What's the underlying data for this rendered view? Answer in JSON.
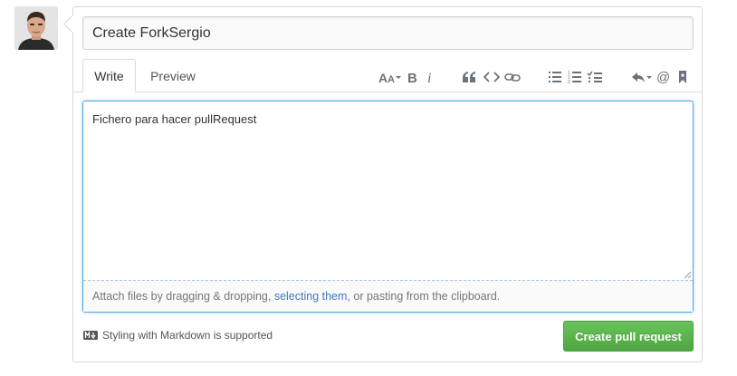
{
  "avatar": {
    "icon": "user-avatar"
  },
  "composer": {
    "title_value": "Create ForkSergio",
    "tabs": [
      {
        "label": "Write",
        "active": true
      },
      {
        "label": "Preview",
        "active": false
      }
    ],
    "toolbar_icons": [
      "header-icon",
      "bold-icon",
      "italic-icon",
      "quote-icon",
      "code-icon",
      "link-icon",
      "unordered-list-icon",
      "ordered-list-icon",
      "task-list-icon",
      "reply-icon",
      "mention-icon",
      "saved-replies-icon"
    ],
    "body_value": "Fichero para hacer pullRequest",
    "attach": {
      "prefix": "Attach files by dragging & dropping, ",
      "link": "selecting them",
      "suffix": ", or pasting from the clipboard."
    },
    "markdown_note": "Styling with Markdown is supported",
    "submit_label": "Create pull request"
  },
  "colors": {
    "accent_blue": "#51a7e8",
    "link_blue": "#4078c0",
    "button_green": "#55a948"
  }
}
